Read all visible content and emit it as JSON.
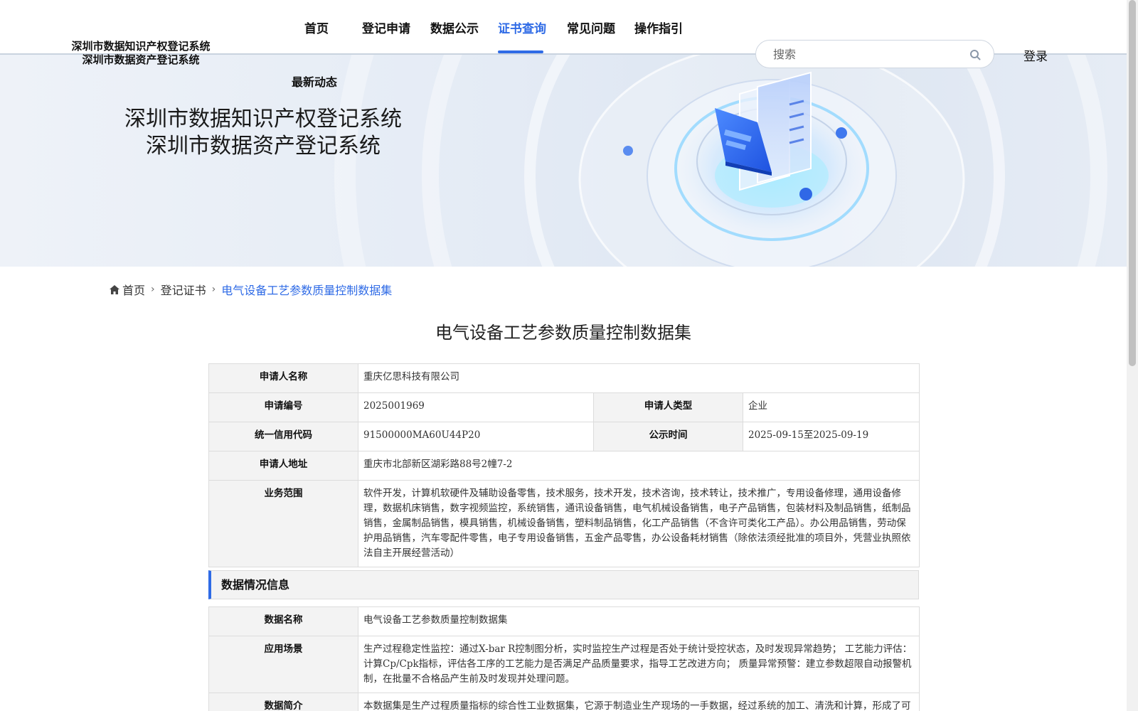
{
  "header": {
    "logo_line1": "深圳市数据知识产权登记系统",
    "logo_line2": "深圳市数据资产登记系统",
    "nav": [
      "首页",
      "登记申请",
      "数据公示",
      "证书查询",
      "常见问题",
      "操作指引"
    ],
    "nav_extra": "最新动态",
    "active_nav": "证书查询",
    "search_placeholder": "搜索",
    "login": "登录"
  },
  "banner": {
    "title_line1": "深圳市数据知识产权登记系统",
    "title_line2": "深圳市数据资产登记系统"
  },
  "breadcrumb": {
    "home": "首页",
    "level1": "登记证书",
    "current": "电气设备工艺参数质量控制数据集"
  },
  "page_title": "电气设备工艺参数质量控制数据集",
  "applicant": {
    "name_label": "申请人名称",
    "name": "重庆亿思科技有限公司",
    "number_label": "申请编号",
    "number": "2025001969",
    "type_label": "申请人类型",
    "type": "企业",
    "credit_label": "统一信用代码",
    "credit": "91500000MA60U44P20",
    "publicity_label": "公示时间",
    "publicity": "2025-09-15至2025-09-19",
    "address_label": "申请人地址",
    "address": "重庆市北部新区湖彩路88号2幢7-2",
    "scope_label": "业务范围",
    "scope": "软件开发，计算机软硬件及辅助设备零售，技术服务，技术开发，技术咨询，技术转让，技术推广，专用设备修理，通用设备修理，数据机床销售，数字视频监控，系统销售，通讯设备销售，电气机械设备销售，电子产品销售，包装材料及制品销售，纸制品销售，金属制品销售，模具销售，机械设备销售，塑料制品销售，化工产品销售（不含许可类化工产品）。办公用品销售，劳动保护用品销售，汽车零配件零售，电子专用设备销售，五金产品零售，办公设备耗材销售（除依法须经批准的项目外，凭营业执照依法自主开展经营活动）"
  },
  "data_section": {
    "title": "数据情况信息",
    "name_label": "数据名称",
    "name": "电气设备工艺参数质量控制数据集",
    "scenario_label": "应用场景",
    "scenario": "生产过程稳定性监控：通过X-bar R控制图分析，实时监控生产过程是否处于统计受控状态，及时发现异常趋势； 工艺能力评估：计算Cp/Cpk指标，评估各工序的工艺能力是否满足产品质量要求，指导工艺改进方向； 质量异常预警：建立参数超限自动报警机制，在批量不合格品产生前及时发现并处理问题。",
    "intro_label": "数据简介",
    "intro": "本数据集是生产过程质量指标的综合性工业数据集，它源于制造业生产现场的一手数据，经过系统的加工、清洗和计算，形成了可用于深度分析和决策支持的高价值信息，该数据集以生产批次和时间序列为索引，记录了产品在关键工艺节点（如焊接、"
  },
  "colors": {
    "accent": "#2f6be6",
    "label_bg": "#f3f3f3",
    "border": "#dcdcdc"
  }
}
